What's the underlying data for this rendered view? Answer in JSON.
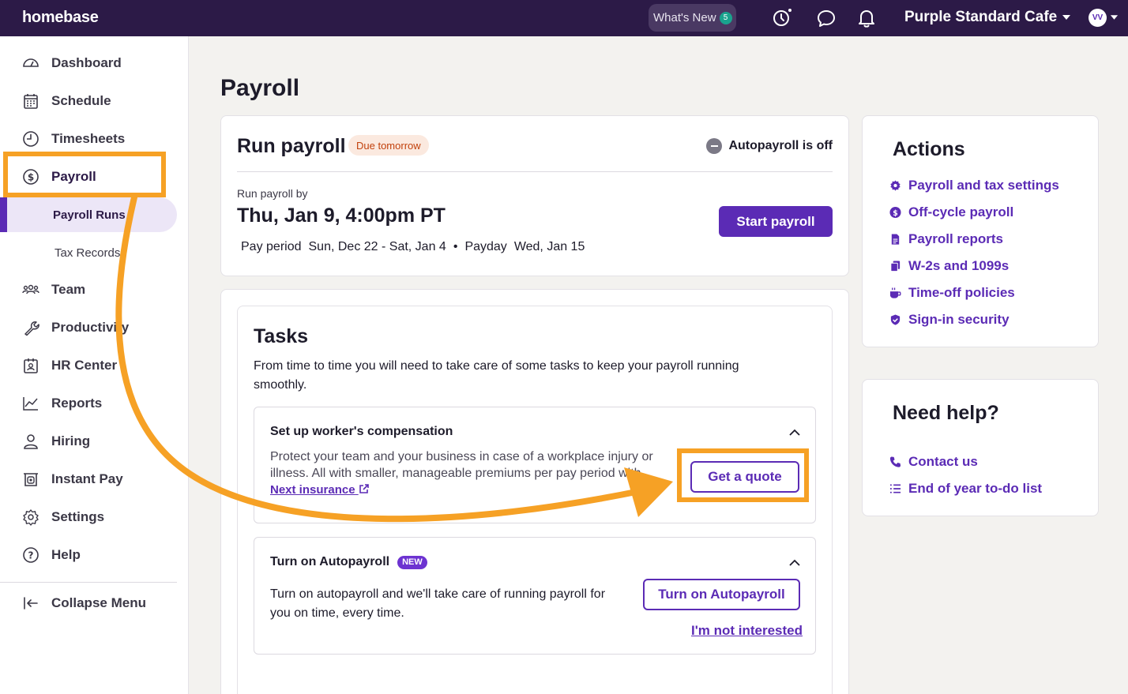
{
  "topbar": {
    "logo": "homebase",
    "whats_new": "What's New",
    "whats_new_count": "5",
    "location": "Purple Standard Cafe",
    "avatar_initials": "VV"
  },
  "sidebar": {
    "items": [
      {
        "label": "Dashboard",
        "icon": "dashboard-icon"
      },
      {
        "label": "Schedule",
        "icon": "calendar-icon"
      },
      {
        "label": "Timesheets",
        "icon": "clock-icon"
      },
      {
        "label": "Payroll",
        "icon": "dollar-icon"
      },
      {
        "label": "Team",
        "icon": "team-icon"
      },
      {
        "label": "Productivity",
        "icon": "wrench-icon"
      },
      {
        "label": "HR Center",
        "icon": "id-badge-icon"
      },
      {
        "label": "Reports",
        "icon": "chart-icon"
      },
      {
        "label": "Hiring",
        "icon": "person-icon"
      },
      {
        "label": "Instant Pay",
        "icon": "instant-pay-icon"
      },
      {
        "label": "Settings",
        "icon": "gear-icon"
      },
      {
        "label": "Help",
        "icon": "help-icon"
      }
    ],
    "sub_items": [
      {
        "label": "Payroll Runs"
      },
      {
        "label": "Tax Records"
      }
    ],
    "collapse_label": "Collapse Menu"
  },
  "page": {
    "title": "Payroll"
  },
  "run_payroll": {
    "title": "Run payroll",
    "due_badge": "Due tomorrow",
    "autopayroll_status": "Autopayroll is off",
    "run_by_label": "Run payroll by",
    "run_by_date": "Thu, Jan 9, 4:00pm PT",
    "pay_period_label": "Pay period",
    "pay_period_value": "Sun, Dec 22 - Sat, Jan 4",
    "separator": "•",
    "payday_label": "Payday",
    "payday_value": "Wed, Jan 15",
    "start_button": "Start payroll"
  },
  "tasks": {
    "title": "Tasks",
    "description": "From time to time you will need to take care of some tasks to keep your payroll running smoothly.",
    "items": [
      {
        "title": "Set up worker's compensation",
        "description": "Protect your team and your business in case of a workplace injury or illness. All with smaller, manageable premiums per pay period with",
        "link": "Next insurance",
        "button": "Get a quote"
      },
      {
        "title": "Turn on Autopayroll",
        "badge": "NEW",
        "description": "Turn on autopayroll and we'll take care of running payroll for you on time, every time.",
        "button": "Turn on Autopayroll",
        "secondary_link": "I'm not interested"
      }
    ]
  },
  "actions": {
    "title": "Actions",
    "items": [
      {
        "label": "Payroll and tax settings",
        "icon": "gear-icon"
      },
      {
        "label": "Off-cycle payroll",
        "icon": "dollar-icon"
      },
      {
        "label": "Payroll reports",
        "icon": "report-icon"
      },
      {
        "label": "W-2s and 1099s",
        "icon": "documents-icon"
      },
      {
        "label": "Time-off policies",
        "icon": "coffee-icon"
      },
      {
        "label": "Sign-in security",
        "icon": "shield-icon"
      }
    ]
  },
  "help": {
    "title": "Need help?",
    "items": [
      {
        "label": "Contact us",
        "icon": "phone-icon"
      },
      {
        "label": "End of year to-do list",
        "icon": "list-icon"
      }
    ]
  },
  "colors": {
    "brand_purple": "#5b2bb5",
    "topbar_bg": "#2c1a47",
    "annotation_orange": "#f6a125"
  }
}
